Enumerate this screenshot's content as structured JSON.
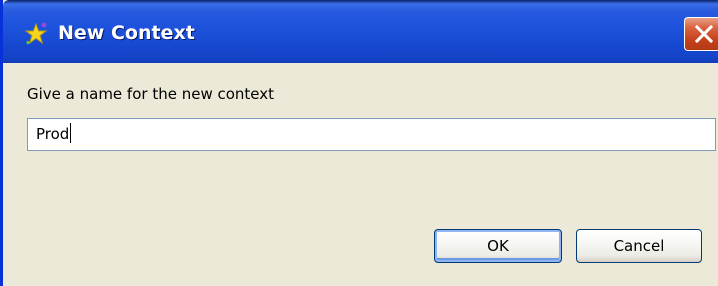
{
  "window": {
    "title": "New Context"
  },
  "dialog": {
    "prompt": "Give a name for the new context",
    "name_value": "Prod"
  },
  "buttons": {
    "ok_label": "OK",
    "cancel_label": "Cancel"
  },
  "icons": {
    "title_icon": "sparkle-star-icon",
    "close_icon": "close-icon"
  },
  "colors": {
    "titlebar": "#1f54de",
    "close": "#d9633f",
    "dialog_bg": "#ece9d8",
    "star": "#f5d51e",
    "input_border": "#7f9db9"
  }
}
